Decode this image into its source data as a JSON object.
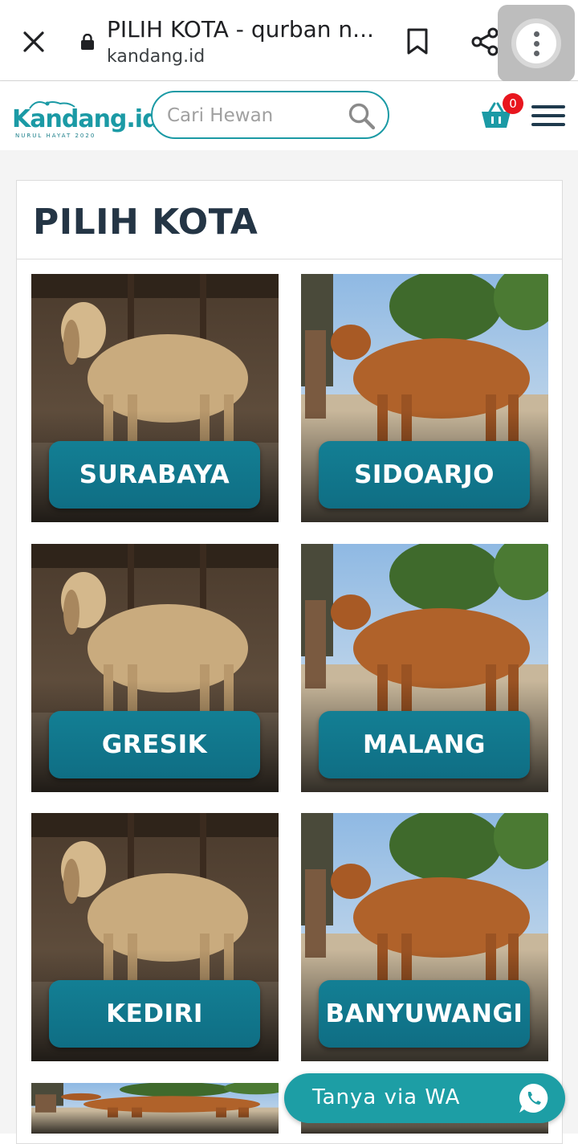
{
  "browser": {
    "tab_title": "PILIH KOTA - qurban n...",
    "url": "kandang.id"
  },
  "header": {
    "logo_text": "Kandang.id",
    "logo_sub": "NURUL HAYAT 2020",
    "search_placeholder": "Cari Hewan",
    "cart_count": "0"
  },
  "page": {
    "title": "PILIH KOTA"
  },
  "cities": [
    {
      "label": "SURABAYA",
      "animal": "goat"
    },
    {
      "label": "SIDOARJO",
      "animal": "cow"
    },
    {
      "label": "GRESIK",
      "animal": "goat"
    },
    {
      "label": "MALANG",
      "animal": "cow"
    },
    {
      "label": "KEDIRI",
      "animal": "goat"
    },
    {
      "label": "BANYUWANGI",
      "animal": "cow"
    }
  ],
  "wa_button": {
    "label": "Tanya via WA"
  },
  "colors": {
    "brand": "#1b9aa5",
    "button": "#137f94",
    "badge": "#e8161e",
    "title": "#243545"
  },
  "icons": [
    "close-icon",
    "lock-icon",
    "bookmark-icon",
    "share-icon",
    "more-vert-icon",
    "search-icon",
    "cart-icon",
    "hamburger-icon",
    "whatsapp-icon"
  ]
}
